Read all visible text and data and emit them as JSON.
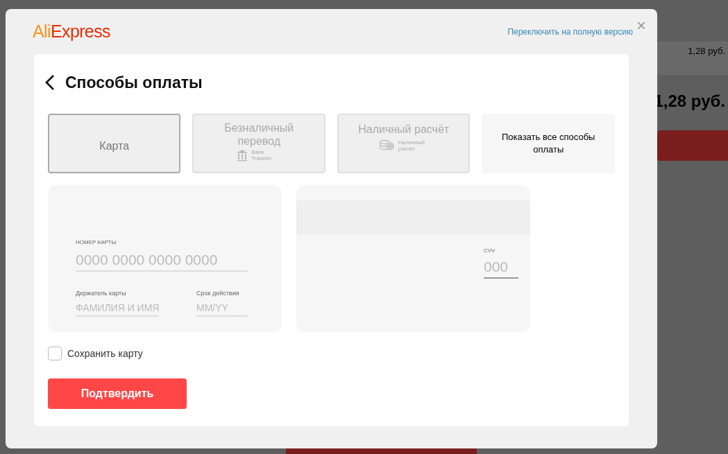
{
  "background": {
    "price_small": "1,28 руб.",
    "price_large": "1,28 руб."
  },
  "dialog": {
    "logo": "AliExpress",
    "switch_link": "Переключить на полную версию",
    "close": "×"
  },
  "title": "Способы оплаты",
  "payment_methods": [
    {
      "kind": "text",
      "label": "Карта",
      "selected": true,
      "disabled": false
    },
    {
      "kind": "bank",
      "label": "Безналичный перевод",
      "sublabel": "Bank Transfer",
      "selected": false,
      "disabled": true
    },
    {
      "kind": "cash",
      "label": "Наличный расчёт",
      "sublabel": "Наличный расчет",
      "selected": false,
      "disabled": true
    },
    {
      "kind": "more",
      "label": "Показать все способы оплаты",
      "selected": false,
      "disabled": false
    }
  ],
  "card_front": {
    "number_label": "НОМЕР КАРТЫ",
    "number_placeholder": "0000 0000 0000 0000",
    "holder_label": "Держатель карты",
    "holder_placeholder": "ФАМИЛИЯ И ИМЯ",
    "expiry_label": "Срок действия",
    "expiry_placeholder": "MM/YY"
  },
  "card_back": {
    "cvv_label": "CVV",
    "cvv_placeholder": "000"
  },
  "save_card": {
    "label": "Сохранить карту",
    "checked": false
  },
  "confirm_button": "Подтвердить"
}
